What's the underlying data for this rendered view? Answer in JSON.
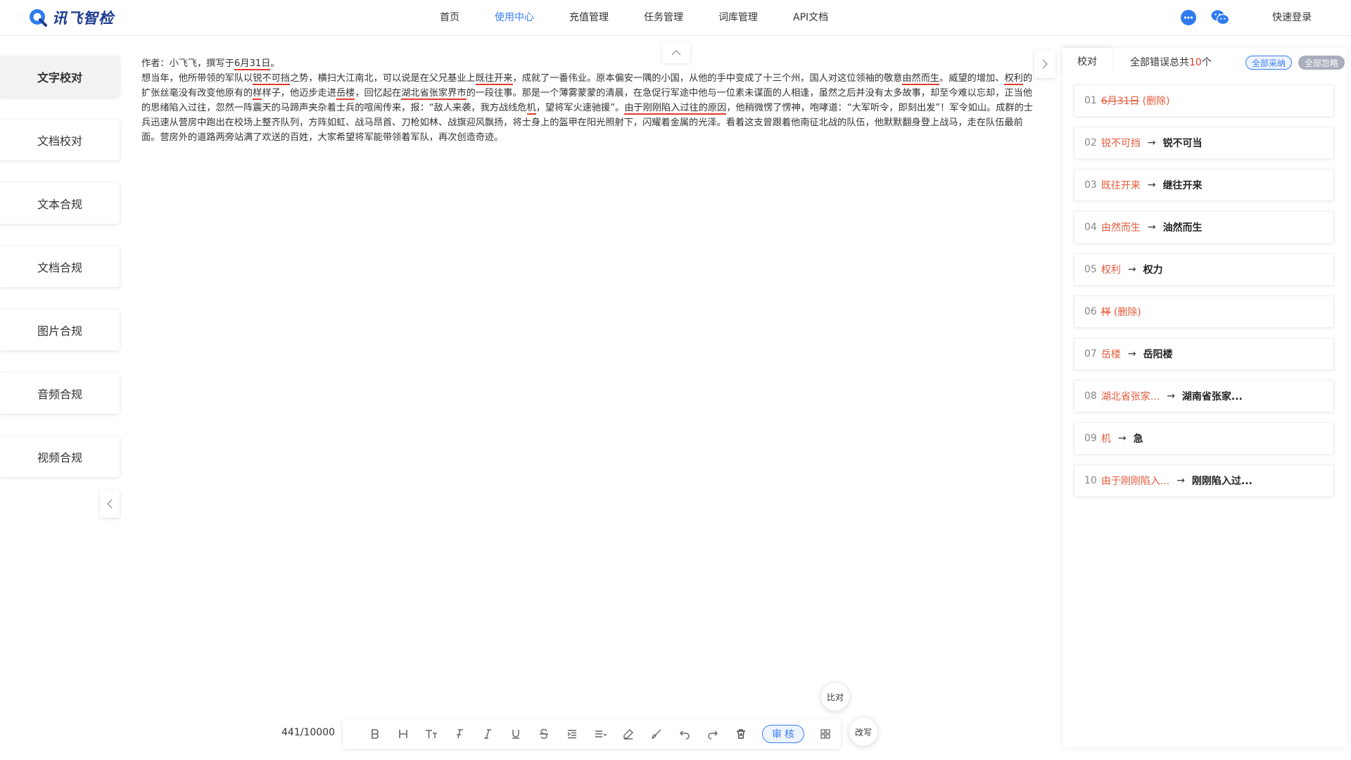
{
  "header": {
    "logo_text": "讯飞智检",
    "nav": [
      "首页",
      "使用中心",
      "充值管理",
      "任务管理",
      "词库管理",
      "API文档"
    ],
    "active_nav": 1,
    "login_label": "快速登录"
  },
  "sidebar": {
    "items": [
      "文字校对",
      "文档校对",
      "文本合规",
      "文档合规",
      "图片合规",
      "音频合规",
      "视频合规"
    ]
  },
  "editor": {
    "line1": [
      "作者：小飞飞，撰写于",
      "6月31日",
      "。"
    ],
    "para": [
      "想当年，他所带领的军队以",
      "锐不可挡",
      "之势，横扫大江南北，可以说是在父兄基业上",
      "既往开来",
      "，成就了一番伟业。原本偏安一隅的小国，从他的手中变成了十三个州，国人对这位领袖的敬意",
      "由然而生",
      "。威望的增加、",
      "权利",
      "的扩张丝毫没有改变他原有的",
      "样",
      "样子，他迈步走进",
      "岳楼",
      "，回忆起在",
      "湖北省张家界市",
      "的一段往事。那是一个薄雾蒙蒙的清晨，在急促行军途中他与一位素未谋面的人相逢，虽然之后并没有太多故事，却至今难以忘却，正当他的思绪陷入过往，忽然一阵震天的马蹄声夹杂着士兵的喧闹传来，报：“敌人来袭，我方战线危",
      "机",
      "，望将军火速驰援”。",
      "由于刚刚陷入过往的原因",
      "，他稍微愣了愣神，咆哮道：“大军听令，即刻出发”！军令如山。成群的士兵迅速从营房中跑出在校场上整齐队列，方阵如虹、战马昂首、刀枪如林、战旗迎风飘扬，将士身上的盔甲在阳光照射下，闪耀着金属的光泽。看着这支曾跟着他南征北战的队伍，他默默翻身登上战马，走在队伍最前面。营房外的道路两旁站满了欢送的百姓，大家希望将军能带领着军队，再次创造奇迹。"
    ]
  },
  "toolbar": {
    "word_count": "441/10000",
    "review_label": "审核",
    "compare_label": "比对",
    "rewrite_label": "改写"
  },
  "panel": {
    "tab_label": "校对",
    "count_prefix": "全部错误总共",
    "count_num": "10",
    "count_suffix": "个",
    "accept_all": "全部采纳",
    "ignore_all": "全部忽略",
    "items": [
      {
        "idx": "01",
        "wrong": "6月31日",
        "strike": true,
        "note": "(删除)",
        "right": ""
      },
      {
        "idx": "02",
        "wrong": "锐不可挡",
        "strike": false,
        "note": "",
        "right": "锐不可当"
      },
      {
        "idx": "03",
        "wrong": "既往开来",
        "strike": false,
        "note": "",
        "right": "继往开来"
      },
      {
        "idx": "04",
        "wrong": "由然而生",
        "strike": false,
        "note": "",
        "right": "油然而生"
      },
      {
        "idx": "05",
        "wrong": "权利",
        "strike": false,
        "note": "",
        "right": "权力"
      },
      {
        "idx": "06",
        "wrong": "样",
        "strike": true,
        "note": "(删除)",
        "right": ""
      },
      {
        "idx": "07",
        "wrong": "岳楼",
        "strike": false,
        "note": "",
        "right": "岳阳楼"
      },
      {
        "idx": "08",
        "wrong": "湖北省张家...",
        "strike": false,
        "note": "",
        "right": "湖南省张家..."
      },
      {
        "idx": "09",
        "wrong": "机",
        "strike": false,
        "note": "",
        "right": "急"
      },
      {
        "idx": "10",
        "wrong": "由于刚刚陷入...",
        "strike": false,
        "note": "",
        "right": "刚刚陷入过..."
      }
    ]
  }
}
